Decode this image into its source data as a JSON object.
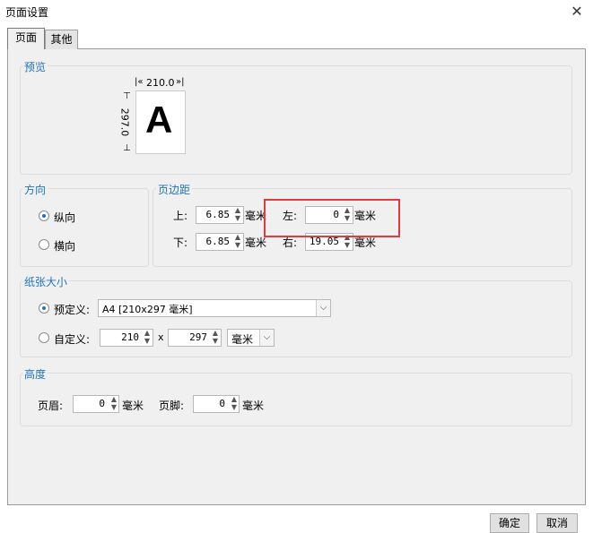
{
  "window": {
    "title": "页面设置"
  },
  "tabs": [
    {
      "label": "页面"
    },
    {
      "label": "其他"
    }
  ],
  "preview": {
    "group_title": "预览",
    "width_label": "210.0",
    "height_label": "297.0",
    "sample_letter": "A"
  },
  "orientation": {
    "group_title": "方向",
    "options": [
      {
        "label": "纵向",
        "selected": true
      },
      {
        "label": "横向",
        "selected": false
      }
    ]
  },
  "margins": {
    "group_title": "页边距",
    "top": {
      "label": "上:",
      "value": "6.85",
      "unit": "毫米"
    },
    "left": {
      "label": "左:",
      "value": "0",
      "unit": "毫米"
    },
    "bottom": {
      "label": "下:",
      "value": "6.85",
      "unit": "毫米"
    },
    "right": {
      "label": "右:",
      "value": "19.05",
      "unit": "毫米"
    }
  },
  "paper_size": {
    "group_title": "纸张大小",
    "predefined": {
      "label": "预定义:",
      "selected": true,
      "value": "A4 [210x297 毫米]"
    },
    "custom": {
      "label": "自定义:",
      "selected": false,
      "width": "210",
      "separator": "x",
      "height": "297",
      "unit": "毫米"
    }
  },
  "height": {
    "group_title": "高度",
    "header": {
      "label": "页眉:",
      "value": "0",
      "unit": "毫米"
    },
    "footer": {
      "label": "页脚:",
      "value": "0",
      "unit": "毫米"
    }
  },
  "buttons": {
    "ok": "确定",
    "cancel": "取消"
  },
  "colors": {
    "accent": "#1e73be",
    "highlight": "#e63a3a"
  }
}
